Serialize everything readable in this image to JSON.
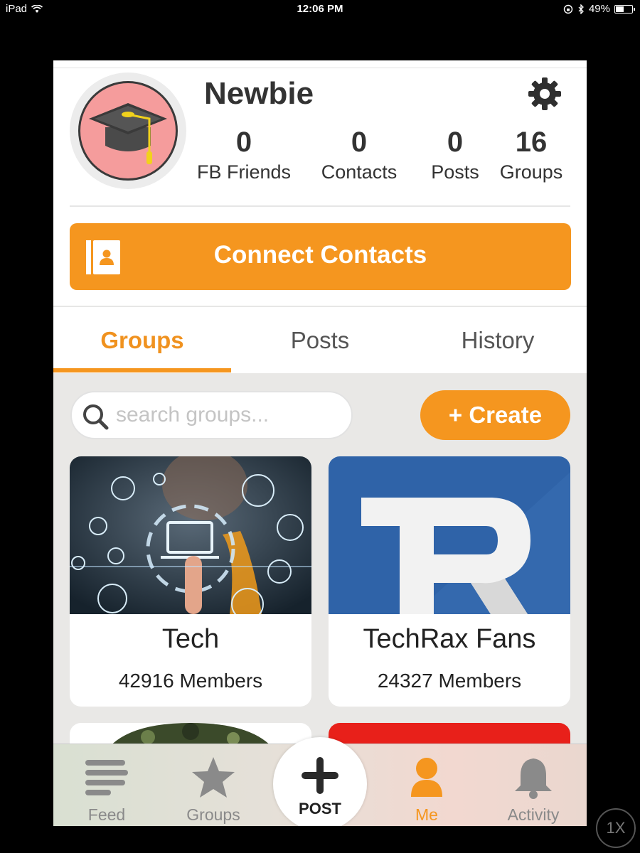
{
  "status_bar": {
    "device": "iPad",
    "time": "12:06 PM",
    "battery": "49%",
    "battery_level": 0.49
  },
  "profile": {
    "name": "Newbie",
    "stats": [
      {
        "value": "0",
        "label": "FB Friends"
      },
      {
        "value": "0",
        "label": "Contacts"
      },
      {
        "value": "0",
        "label": "Posts"
      },
      {
        "value": "16",
        "label": "Groups"
      }
    ]
  },
  "connect_button": {
    "label": "Connect Contacts"
  },
  "tabs": [
    {
      "label": "Groups",
      "active": true
    },
    {
      "label": "Posts",
      "active": false
    },
    {
      "label": "History",
      "active": false
    }
  ],
  "search": {
    "placeholder": "search groups...",
    "value": ""
  },
  "create_button": {
    "label": "+ Create"
  },
  "groups": [
    {
      "title": "Tech",
      "members": "42916 Members"
    },
    {
      "title": "TechRax Fans",
      "members": "24327 Members"
    }
  ],
  "bottom_nav": {
    "items": [
      {
        "label": "Feed",
        "icon": "feed-icon",
        "active": false
      },
      {
        "label": "Groups",
        "icon": "star-icon",
        "active": false
      },
      {
        "label": "POST",
        "icon": "plus-icon",
        "active": false
      },
      {
        "label": "Me",
        "icon": "person-icon",
        "active": true
      },
      {
        "label": "Activity",
        "icon": "bell-icon",
        "active": false
      }
    ]
  },
  "zoom_button": {
    "label": "1X"
  },
  "colors": {
    "accent": "#f5961f",
    "avatar_bg": "#f59c9c",
    "techrax_blue": "#2f63a8",
    "red_card": "#e8201a"
  }
}
